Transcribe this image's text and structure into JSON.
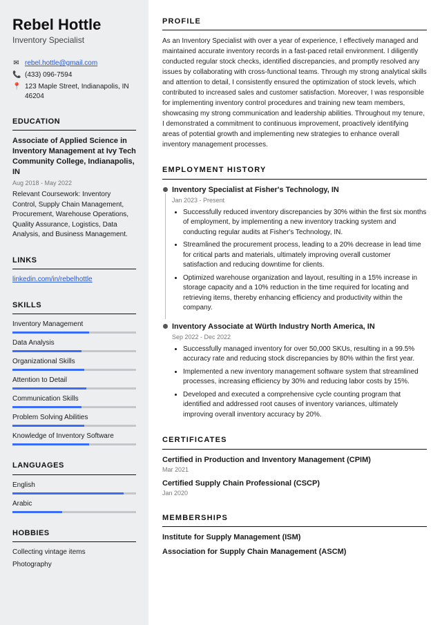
{
  "name": "Rebel Hottle",
  "jobtitle": "Inventory Specialist",
  "contact": {
    "email": "rebel.hottle@gmail.com",
    "phone": "(433) 096-7594",
    "address": "123 Maple Street, Indianapolis, IN 46204"
  },
  "sections": {
    "education": "EDUCATION",
    "links": "LINKS",
    "skills": "SKILLS",
    "languages": "LANGUAGES",
    "hobbies": "HOBBIES",
    "profile": "PROFILE",
    "employment": "EMPLOYMENT HISTORY",
    "certificates": "CERTIFICATES",
    "memberships": "MEMBERSHIPS"
  },
  "education": {
    "degree": "Associate of Applied Science in Inventory Management at Ivy Tech Community College, Indianapolis, IN",
    "dates": "Aug 2018 - May 2022",
    "coursework": "Relevant Coursework: Inventory Control, Supply Chain Management, Procurement, Warehouse Operations, Quality Assurance, Logistics, Data Analysis, and Business Management."
  },
  "links": {
    "linkedin": "linkedin.com/in/rebelhottle"
  },
  "skills": [
    {
      "name": "Inventory Management",
      "pct": 62
    },
    {
      "name": "Data Analysis",
      "pct": 56
    },
    {
      "name": "Organizational Skills",
      "pct": 58
    },
    {
      "name": "Attention to Detail",
      "pct": 60
    },
    {
      "name": "Communication Skills",
      "pct": 56
    },
    {
      "name": "Problem Solving Abilities",
      "pct": 58
    },
    {
      "name": "Knowledge of Inventory Software",
      "pct": 62
    }
  ],
  "languages": [
    {
      "name": "English",
      "pct": 90
    },
    {
      "name": "Arabic",
      "pct": 40
    }
  ],
  "hobbies": [
    "Collecting vintage items",
    "Photography"
  ],
  "profile": "As an Inventory Specialist with over a year of experience, I effectively managed and maintained accurate inventory records in a fast-paced retail environment. I diligently conducted regular stock checks, identified discrepancies, and promptly resolved any issues by collaborating with cross-functional teams. Through my strong analytical skills and attention to detail, I consistently ensured the optimization of stock levels, which contributed to increased sales and customer satisfaction. Moreover, I was responsible for implementing inventory control procedures and training new team members, showcasing my strong communication and leadership abilities. Throughout my tenure, I demonstrated a commitment to continuous improvement, proactively identifying areas of potential growth and implementing new strategies to enhance overall inventory management processes.",
  "jobs": [
    {
      "title": "Inventory Specialist at Fisher's Technology, IN",
      "dates": "Jan 2023 - Present",
      "bullets": [
        "Successfully reduced inventory discrepancies by 30% within the first six months of employment, by implementing a new inventory tracking system and conducting regular audits at Fisher's Technology, IN.",
        "Streamlined the procurement process, leading to a 20% decrease in lead time for critical parts and materials, ultimately improving overall customer satisfaction and reducing downtime for clients.",
        "Optimized warehouse organization and layout, resulting in a 15% increase in storage capacity and a 10% reduction in the time required for locating and retrieving items, thereby enhancing efficiency and productivity within the company."
      ]
    },
    {
      "title": "Inventory Associate at Würth Industry North America, IN",
      "dates": "Sep 2022 - Dec 2022",
      "bullets": [
        "Successfully managed inventory for over 50,000 SKUs, resulting in a 99.5% accuracy rate and reducing stock discrepancies by 80% within the first year.",
        "Implemented a new inventory management software system that streamlined processes, increasing efficiency by 30% and reducing labor costs by 15%.",
        "Developed and executed a comprehensive cycle counting program that identified and addressed root causes of inventory variances, ultimately improving overall inventory accuracy by 20%."
      ]
    }
  ],
  "certificates": [
    {
      "title": "Certified in Production and Inventory Management (CPIM)",
      "date": "Mar 2021"
    },
    {
      "title": "Certified Supply Chain Professional (CSCP)",
      "date": "Jan 2020"
    }
  ],
  "memberships": [
    "Institute for Supply Management (ISM)",
    "Association for Supply Chain Management (ASCM)"
  ]
}
